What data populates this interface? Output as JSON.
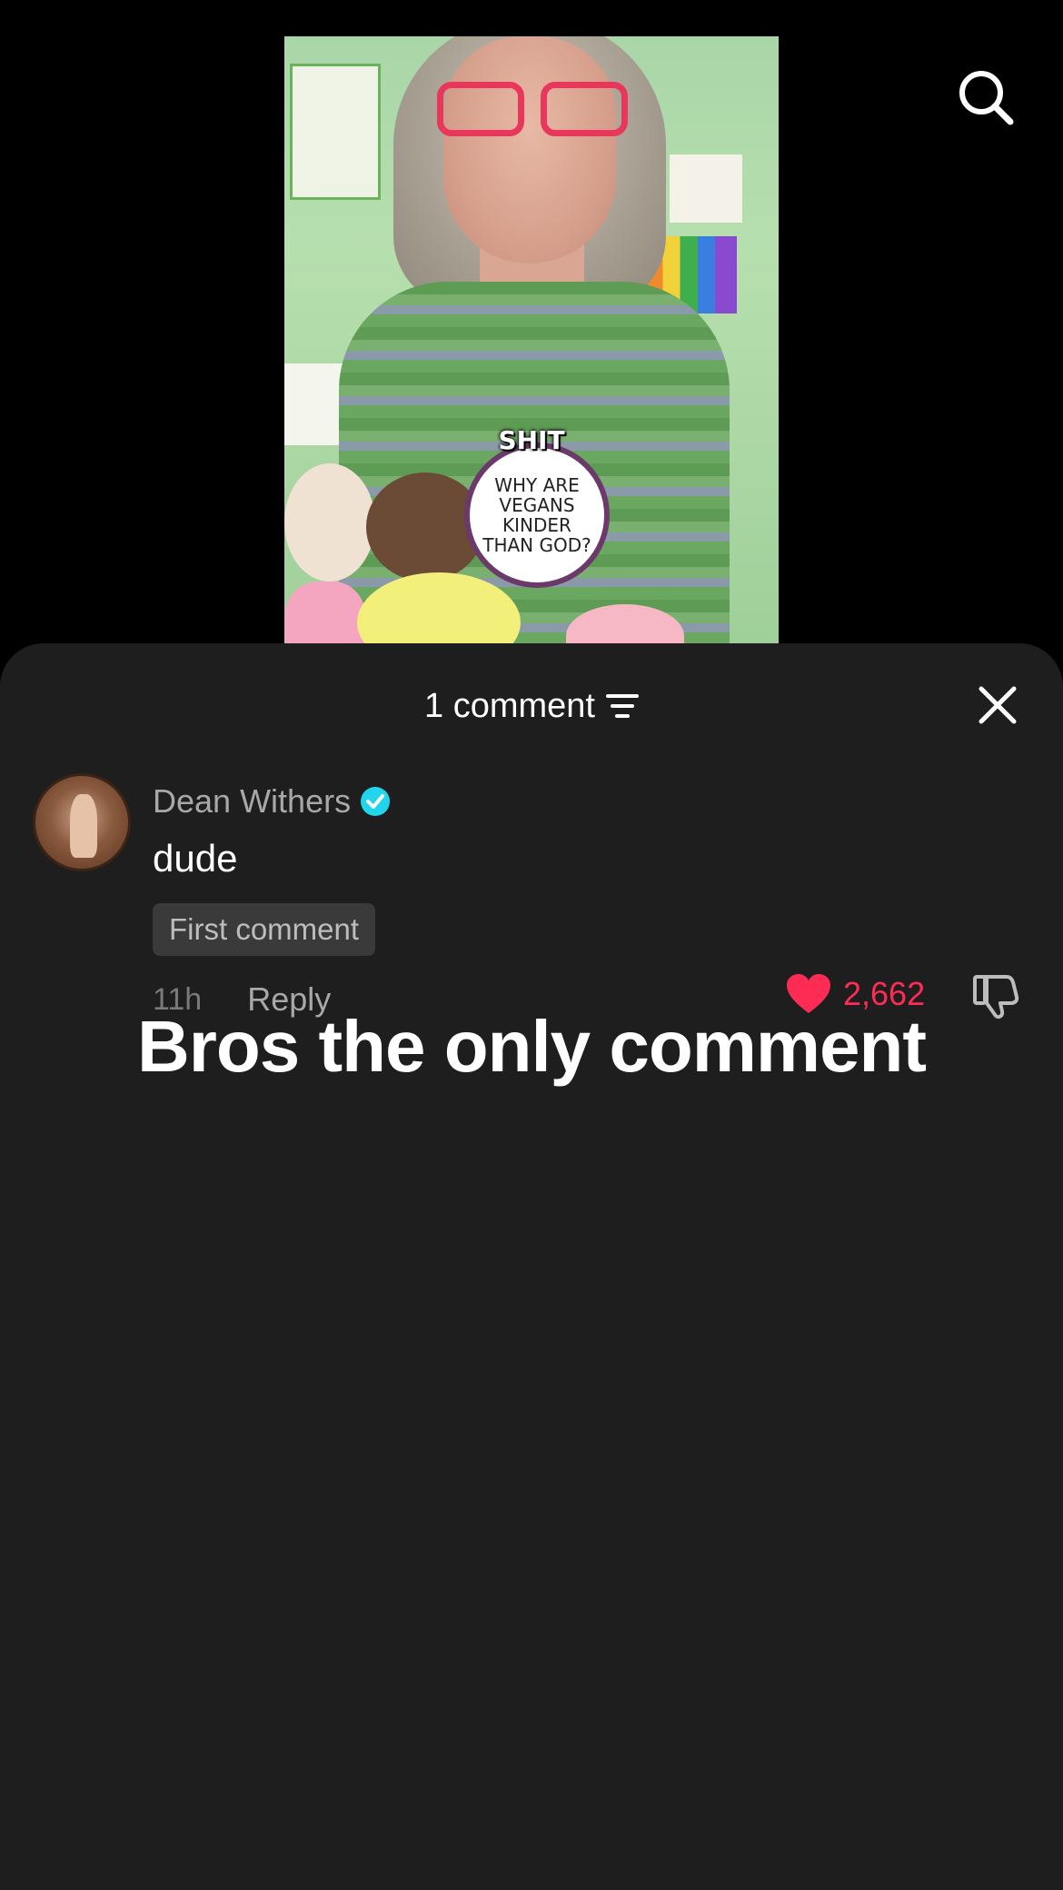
{
  "video": {
    "caption_word": "SHIT",
    "badge_text": "WHY ARE VEGANS KINDER THAN GOD?"
  },
  "top_bar": {
    "search_icon": "search-icon"
  },
  "comments_sheet": {
    "title": "1 comment",
    "sort_icon": "sort-icon",
    "close_icon": "close-icon",
    "comments": [
      {
        "author": "Dean Withers",
        "verified": true,
        "text": "dude",
        "badge": "First comment",
        "time": "11h",
        "reply_label": "Reply",
        "likes": "2,662",
        "liked": true
      }
    ]
  },
  "overlay_caption": "Bros the only comment",
  "colors": {
    "sheet_bg": "#1e1e1e",
    "like_red": "#fe2c55",
    "verified_blue": "#20d5ec"
  }
}
